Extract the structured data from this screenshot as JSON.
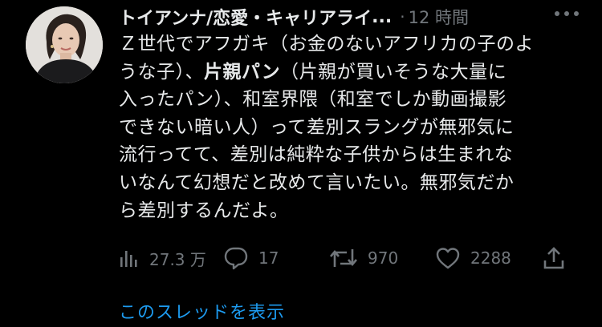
{
  "author": {
    "display_name": "トイアンナ/恋愛・キャリアライ",
    "ellipsis": "...",
    "separator": "·",
    "time": "12 時間"
  },
  "post": {
    "line1": "Ｚ世代でアフガキ（お金のないアフリカの子のよ",
    "line2_pre": "うな子）、",
    "line2_bold": "片親パン",
    "line2_post": "（片親が買いそうな大量に",
    "line3": "入ったパン）、和室界隈（和室でしか動画撮影",
    "line4": "できない暗い人）って差別スラングが無邪気に",
    "line5": "流行ってて、差別は純粋な子供からは生まれな",
    "line6": "いなんて幻想だと改めて言いたい。無邪気だか",
    "line7": "ら差別するんだよ。"
  },
  "actions": {
    "views": "27.3 万",
    "replies": "17",
    "reposts": "970",
    "likes": "2288"
  },
  "thread_link": "このスレッドを表示",
  "colors": {
    "background": "#000000",
    "text": "#e7e9ea",
    "muted": "#71767b",
    "link": "#1d9bf0"
  },
  "icons": {
    "more": "more-dots-icon",
    "views": "views-bar-chart-icon",
    "reply": "reply-bubble-icon",
    "repost": "repost-arrows-icon",
    "like": "heart-icon",
    "share": "share-upload-icon"
  }
}
